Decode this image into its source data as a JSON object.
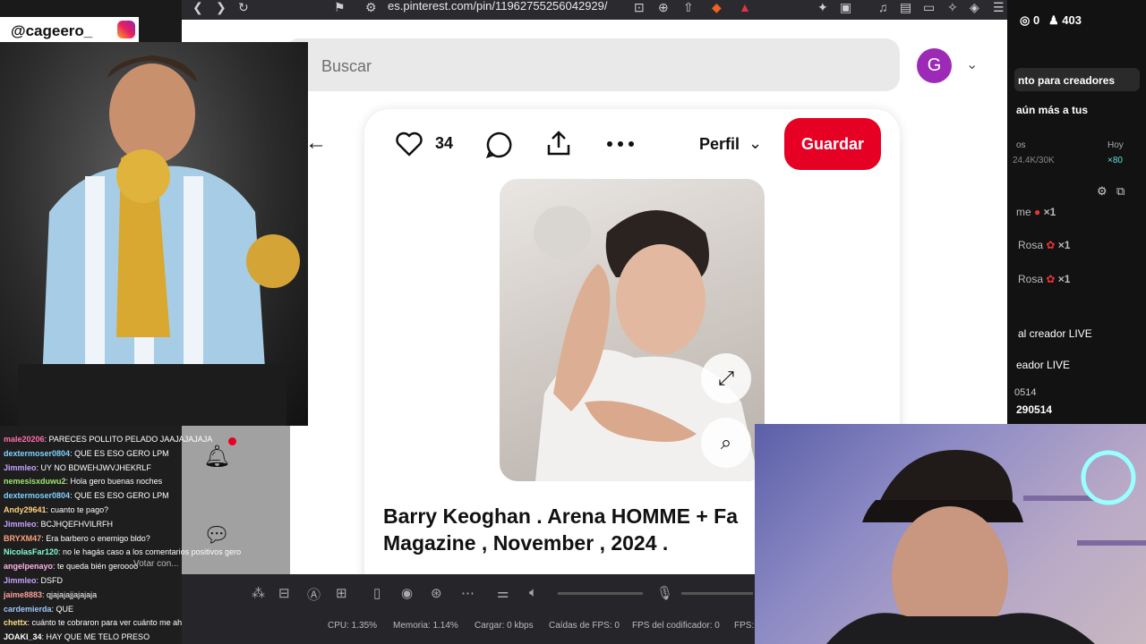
{
  "browser": {
    "url": "es.pinterest.com/pin/11962755256042929/"
  },
  "pinterest": {
    "search_placeholder": "Buscar",
    "avatar_letter": "G",
    "like_count": "34",
    "profile_label": "Perfil",
    "save_label": "Guardar",
    "pin_title": "Barry Keoghan . Arena HOMME + Fa Magazine , November , 2024 ."
  },
  "overlay": {
    "handle": "@cageero_"
  },
  "right_panel": {
    "coins": "0",
    "followers": "403",
    "creator_tools": "nto para creadores",
    "reach_more": "aún más a tus",
    "stat_label": "os",
    "stat_today": "Hoy",
    "stat_value": "24.4K/30K",
    "stat_mult": "×80",
    "gift_1": "me",
    "gift_1_count": "×1",
    "gift_2": "Rosa",
    "gift_2_count": "×1",
    "gift_3": "Rosa",
    "gift_3_count": "×1",
    "live_creator": "al creador LIVE",
    "live_creator_2": "eador LIVE",
    "id_1": "0514",
    "id_2": "290514"
  },
  "chat": [
    {
      "user": "male20206",
      "text": ": PARECES POLLITO PELADO JAAJAJAJAJA"
    },
    {
      "user": "dextermoser0804",
      "text": ": QUE ES ESO GERO LPM"
    },
    {
      "user": "Jimmleo",
      "text": ": UY NO BDWEHJWVJHEKRLF"
    },
    {
      "user": "nemesisxduwu2",
      "text": ": Hola gero buenas noches"
    },
    {
      "user": "dextermoser0804",
      "text": ": QUE ES ESO GERO LPM"
    },
    {
      "user": "Andy29641",
      "text": ": cuanto te pago?"
    },
    {
      "user": "Jimmleo",
      "text": ": BCJHQEFHVILRFH"
    },
    {
      "user": "BRYXM47",
      "text": ": Era barbero o enemigo bldo?"
    },
    {
      "user": "NicolasFar120",
      "text": ": no le hagás caso a los comentarios positivos gero"
    },
    {
      "user": "angelpenayo",
      "text": ": te queda bién geroooo"
    },
    {
      "user": "Jimmleo",
      "text": ": DSFD"
    },
    {
      "user": "jaime8883",
      "text": ": qjajajajjajajaja"
    },
    {
      "user": "cardemierda",
      "text": ": QUE"
    },
    {
      "user": "chettx",
      "text": ": cuánto te cobraron para ver cuánto me ahorro"
    },
    {
      "user": "JOAKI_34",
      "text": ": HAY QUE ME TELO PRESO"
    }
  ],
  "side_menu": {
    "vote_text": "Votar con..."
  },
  "obs": {
    "cpu": "CPU: 1.35%",
    "memory": "Memoria: 1.14%",
    "load": "Cargar: 0 kbps",
    "drops": "Caídas de FPS: 0",
    "encoder": "FPS del codificador: 0",
    "fps": "FPS:"
  },
  "colors": {
    "pinterest_red": "#e60023",
    "avatar_purple": "#9c2ab7"
  }
}
